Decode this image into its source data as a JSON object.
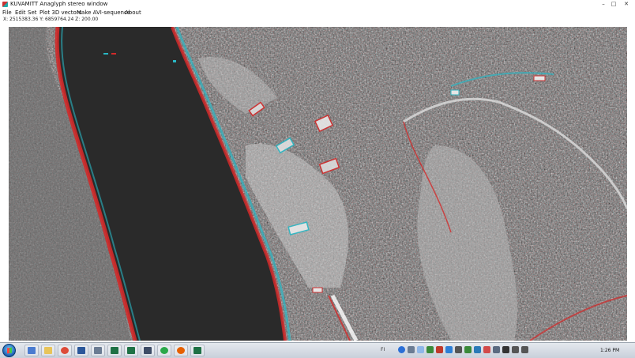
{
  "window": {
    "title": "KUVAMITT Anaglyph stereo window",
    "minimize_glyph": "–",
    "maximize_glyph": "□",
    "close_glyph": "✕"
  },
  "menu": [
    "File",
    "Edit",
    "Set",
    "Plot 3D vectors",
    "Make AVI-sequence",
    "About"
  ],
  "coordinates": "X: 2515383.36  Y: 6859764.24  Z: 200.00",
  "viewport": {
    "content": "red-cyan anaglyph aerial image of lake shoreline and forest",
    "accent_red": "#d22a2a",
    "accent_cyan": "#29b7c4"
  },
  "taskbar": {
    "start_icon": "windows-start-icon",
    "apps": [
      {
        "icon": "application-icon",
        "color": "#4a7bd0"
      },
      {
        "icon": "folder-icon",
        "color": "#e8c45a"
      },
      {
        "icon": "chrome-icon",
        "color": "#dd4b39"
      },
      {
        "icon": "word-icon",
        "color": "#2b579a"
      },
      {
        "icon": "network-icon",
        "color": "#6b7c93"
      },
      {
        "icon": "excel-icon",
        "color": "#1e7145"
      },
      {
        "icon": "excel-icon",
        "color": "#1e7145"
      },
      {
        "icon": "monitor-icon",
        "color": "#3d4c66"
      },
      {
        "icon": "green-app-icon",
        "color": "#2aa84a"
      },
      {
        "icon": "firefox-icon",
        "color": "#e66000"
      },
      {
        "icon": "excel-icon",
        "color": "#1e7145"
      }
    ],
    "tray_label": "FI",
    "tray_icons": [
      "help-icon",
      "network-icon",
      "cloud-icon",
      "shield-icon",
      "antivirus-icon",
      "dropbox-icon",
      "volume-icon",
      "battery-icon",
      "chat-icon",
      "flag-icon",
      "update-icon",
      "power-icon",
      "wifi-icon",
      "speaker-icon"
    ],
    "clock": "1:26 PM"
  }
}
